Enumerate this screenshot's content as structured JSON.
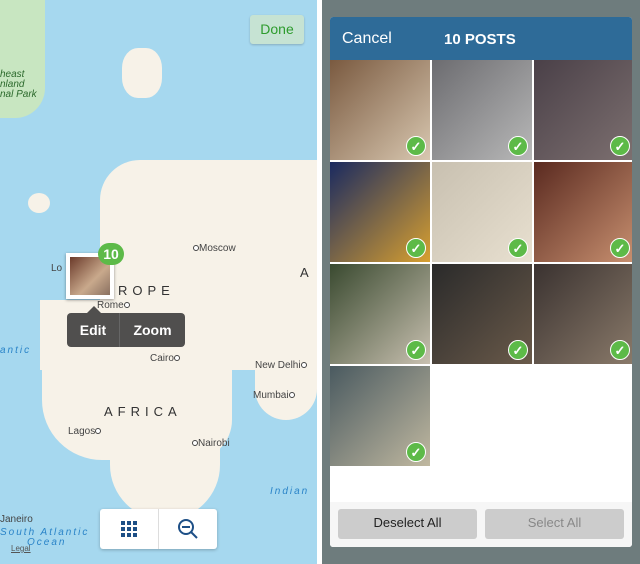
{
  "map": {
    "done_label": "Done",
    "labels": {
      "park": "heast\nnland\nnal Park",
      "moscow": "Moscow",
      "europe": "ROPE",
      "asia": "A",
      "london": "Lo",
      "rome": "Rome",
      "cairo": "Cairo",
      "new_delhi": "New Delhi",
      "mumbai": "Mumbai",
      "africa": "AFRICA",
      "lagos": "Lagos",
      "nairobi": "Nairobi",
      "atlantic": "antic",
      "indian": "Indian",
      "janeiro": "Janeiro",
      "south_atlantic": "South Atlantic",
      "ocean": "Ocean",
      "legal": "Legal"
    },
    "cluster_count": "10",
    "popup": {
      "edit": "Edit",
      "zoom": "Zoom"
    },
    "tools": [
      {
        "icon": "grid-icon"
      },
      {
        "icon": "zoom-out-icon"
      }
    ],
    "accent": "#5dba48"
  },
  "picker": {
    "cancel_label": "Cancel",
    "title": "10 POSTS",
    "header_color": "#2e6b98",
    "photos": [
      {
        "selected": true,
        "colors": [
          "#7a5a40",
          "#d8c7b0"
        ]
      },
      {
        "selected": true,
        "colors": [
          "#6c6c70",
          "#b8b8b8"
        ]
      },
      {
        "selected": true,
        "colors": [
          "#4a4048",
          "#7d7070"
        ]
      },
      {
        "selected": true,
        "colors": [
          "#1a2a60",
          "#d8a030"
        ]
      },
      {
        "selected": true,
        "colors": [
          "#c8c0b0",
          "#e8e0d0"
        ]
      },
      {
        "selected": true,
        "colors": [
          "#5a2a20",
          "#c89070"
        ]
      },
      {
        "selected": true,
        "colors": [
          "#3a4a30",
          "#c8c0b0"
        ]
      },
      {
        "selected": true,
        "colors": [
          "#2a2a2a",
          "#6a5a4a"
        ]
      },
      {
        "selected": true,
        "colors": [
          "#3a3230",
          "#8a7a6a"
        ]
      },
      {
        "selected": true,
        "colors": [
          "#4a5a60",
          "#c0b8a0"
        ]
      }
    ],
    "deselect_label": "Deselect All",
    "select_label": "Select All"
  }
}
